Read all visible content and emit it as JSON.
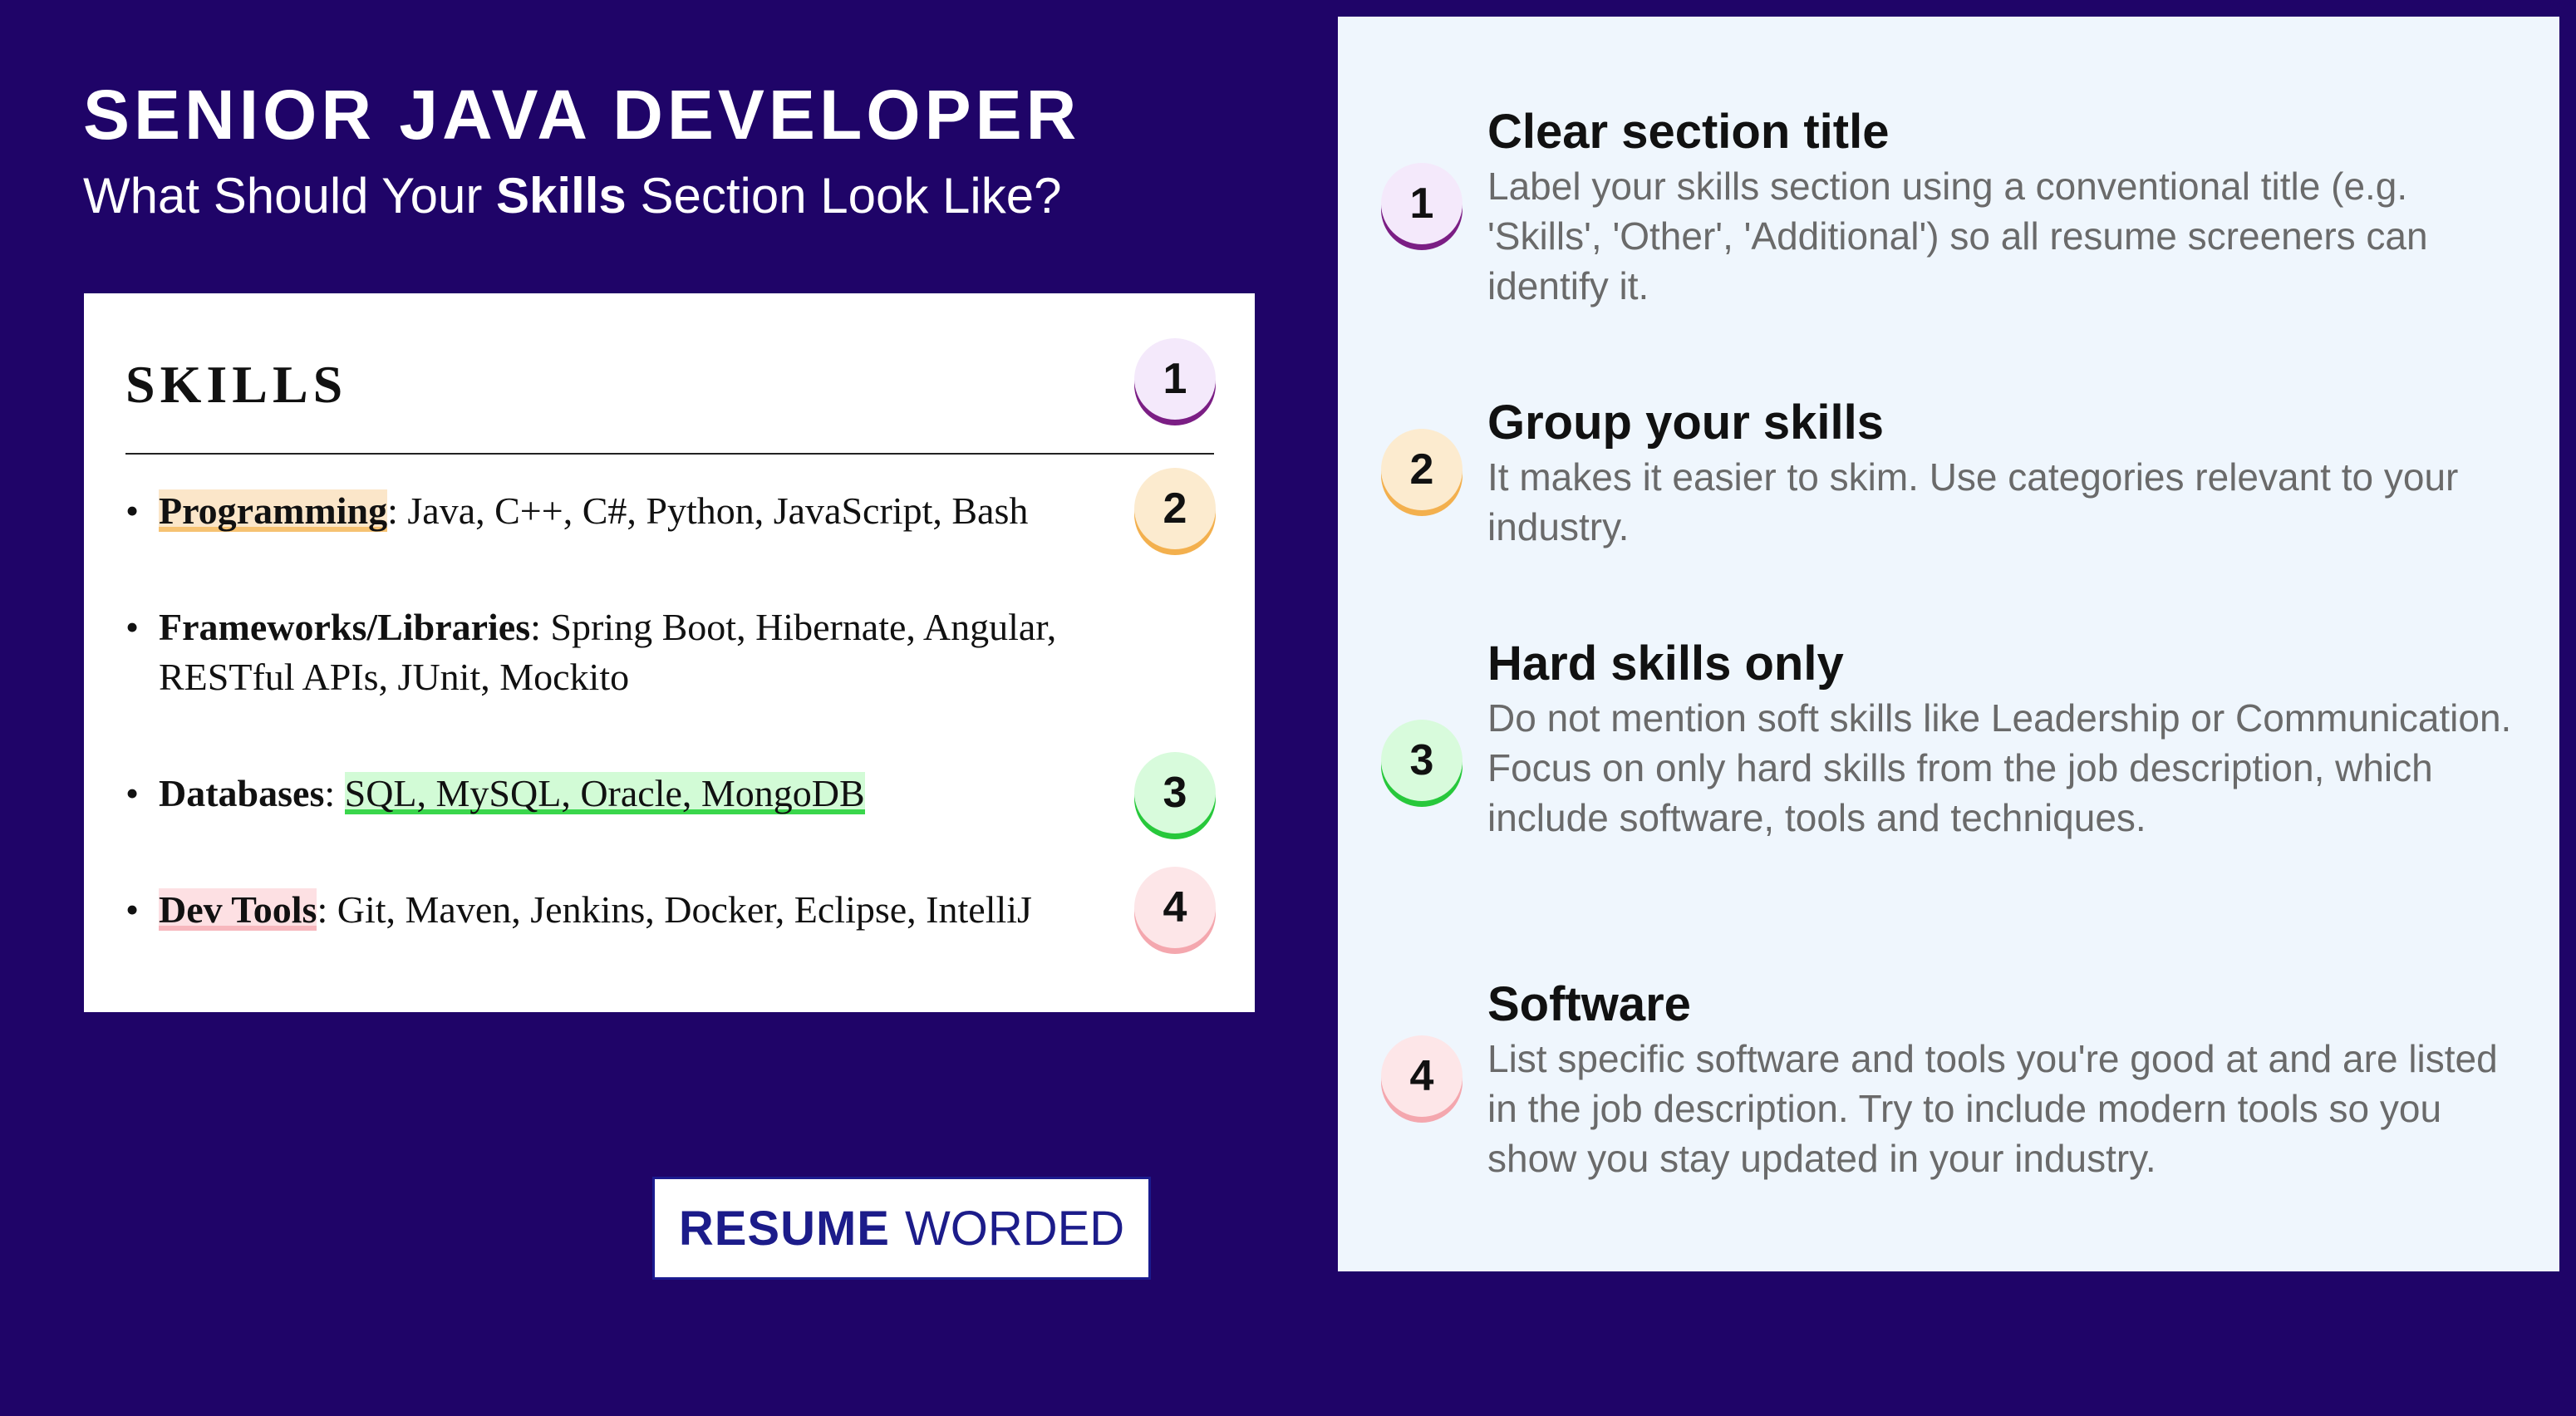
{
  "header": {
    "title": "SENIOR JAVA DEVELOPER",
    "subtitle_before": "What Should Your ",
    "subtitle_bold": "Skills",
    "subtitle_after": " Section Look Like?"
  },
  "resume_card": {
    "heading": "SKILLS",
    "items": [
      {
        "category": "Programming",
        "sep": ": ",
        "values": "Java, C++, C#, Python, JavaScript, Bash"
      },
      {
        "category": "Frameworks/Libraries",
        "sep": ": ",
        "values": "Spring Boot, Hibernate, Angular, RESTful APIs, JUnit, Mockito"
      },
      {
        "category": "Databases",
        "sep": ": ",
        "values": "SQL, MySQL, Oracle, MongoDB"
      },
      {
        "category": "Dev Tools",
        "sep": ": ",
        "values": "Git, Maven, Jenkins, Docker, Eclipse, IntelliJ"
      }
    ],
    "bullet": "•",
    "badges": [
      "1",
      "2",
      "3",
      "4"
    ]
  },
  "logo": {
    "bold": "RESUME",
    "light": "WORDED"
  },
  "tips": [
    {
      "number": "1",
      "title": "Clear section title",
      "desc": "Label your skills section using a conventional title (e.g. 'Skills', 'Other', 'Additional') so all resume screeners can identify it."
    },
    {
      "number": "2",
      "title": "Group your skills",
      "desc": "It makes it easier to skim. Use categories relevant to your industry."
    },
    {
      "number": "3",
      "title": "Hard skills only",
      "desc": "Do not mention soft skills like Leadership or Communication. Focus on only hard skills from the job description, which include software, tools and techniques."
    },
    {
      "number": "4",
      "title": "Software",
      "desc": "List specific software and tools you're good at and are listed in the job description. Try to include modern tools so you show you stay updated in your industry."
    }
  ],
  "colors": {
    "background": "#1f0468",
    "panel": "#eff6fd",
    "badge_1": "#7b1e84",
    "badge_2": "#f3b04e",
    "badge_3": "#27c83b",
    "badge_4": "#f4a7ae"
  }
}
